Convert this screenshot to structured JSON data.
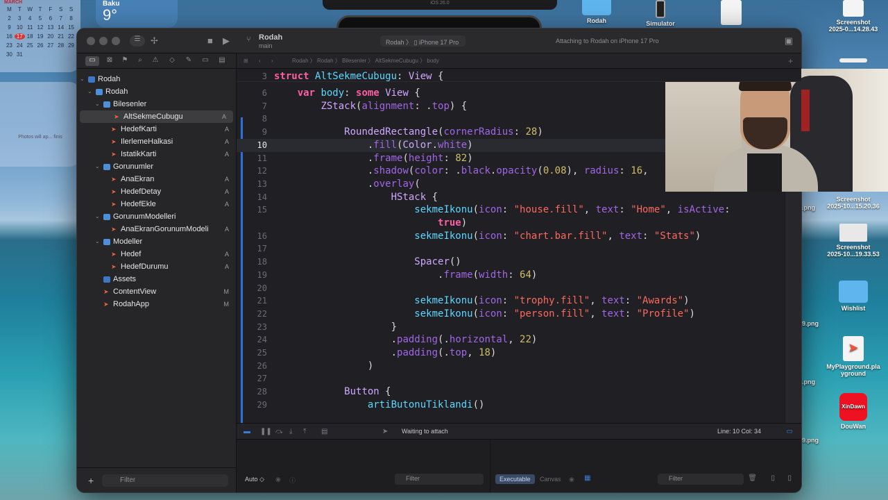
{
  "desktop": {
    "calendar": {
      "month": "MARCH",
      "weekdays": [
        "M",
        "T",
        "W",
        "T",
        "F",
        "S",
        "S"
      ],
      "rows": [
        [
          "2",
          "3",
          "4",
          "5",
          "6",
          "7",
          "8"
        ],
        [
          "9",
          "10",
          "11",
          "12",
          "13",
          "14",
          "15"
        ],
        [
          "16",
          "17",
          "18",
          "19",
          "20",
          "21",
          "22"
        ],
        [
          "23",
          "24",
          "25",
          "26",
          "27",
          "28",
          "29"
        ],
        [
          "30",
          "31",
          "",
          "",
          "",
          "",
          ""
        ]
      ],
      "today": "17"
    },
    "weather": {
      "city": "Baku",
      "temp": "9°"
    },
    "photos_widget_text": "Photos will ap... finis",
    "top_island_text": "iOS 26.0",
    "icons": [
      {
        "label": "Rodah",
        "type": "folder"
      },
      {
        "label": "Simulator",
        "type": "simulator"
      },
      {
        "label": "Screenshot\n2025-0...14.28.43",
        "type": "file"
      },
      {
        "label": "Screenshot\n2025-10...15.20.36",
        "type": "shot"
      },
      {
        "label": "Screenshot\n2025-10...19.33.53",
        "type": "shot"
      },
      {
        "label": "Wishlist",
        "type": "folder"
      },
      {
        "label": "MyPlayground.pla\nyground",
        "type": "swift"
      },
      {
        "label": "DouWan",
        "type": "app"
      }
    ],
    "side_labels": [
      ".png",
      "9.png",
      ".png",
      "9.png"
    ]
  },
  "xcode": {
    "scheme": {
      "name": "Rodah",
      "branch": "main"
    },
    "run_destination": {
      "project": "Rodah",
      "device": "iPhone 17 Pro"
    },
    "status": "Attaching to Rodah on iPhone 17 Pro",
    "jumpbar": [
      "Rodah",
      "Rodah",
      "Bilesenler",
      "AltSekmeCubugu",
      "body"
    ],
    "navigator": {
      "tree": [
        {
          "label": "Rodah",
          "depth": 0,
          "kind": "proj",
          "chev": "⌄",
          "badge": ""
        },
        {
          "label": "Rodah",
          "depth": 1,
          "kind": "folder",
          "chev": "⌄",
          "badge": ""
        },
        {
          "label": "Bilesenler",
          "depth": 2,
          "kind": "folder",
          "chev": "⌄",
          "badge": ""
        },
        {
          "label": "AltSekmeCubugu",
          "depth": 3,
          "kind": "swift",
          "chev": "",
          "badge": "A",
          "selected": true
        },
        {
          "label": "HedefKarti",
          "depth": 3,
          "kind": "swift",
          "chev": "",
          "badge": "A"
        },
        {
          "label": "IlerlemeHalkasi",
          "depth": 3,
          "kind": "swift",
          "chev": "",
          "badge": "A"
        },
        {
          "label": "IstatikKarti",
          "depth": 3,
          "kind": "swift",
          "chev": "",
          "badge": "A"
        },
        {
          "label": "Gorunumler",
          "depth": 2,
          "kind": "folder",
          "chev": "⌄",
          "badge": ""
        },
        {
          "label": "AnaEkran",
          "depth": 3,
          "kind": "swift",
          "chev": "",
          "badge": "A"
        },
        {
          "label": "HedefDetay",
          "depth": 3,
          "kind": "swift",
          "chev": "",
          "badge": "A"
        },
        {
          "label": "HedefEkle",
          "depth": 3,
          "kind": "swift",
          "chev": "",
          "badge": "A"
        },
        {
          "label": "GorunumModelleri",
          "depth": 2,
          "kind": "folder",
          "chev": "⌄",
          "badge": ""
        },
        {
          "label": "AnaEkranGorunumModeli",
          "depth": 3,
          "kind": "swift",
          "chev": "",
          "badge": "A"
        },
        {
          "label": "Modeller",
          "depth": 2,
          "kind": "folder",
          "chev": "⌄",
          "badge": ""
        },
        {
          "label": "Hedef",
          "depth": 3,
          "kind": "swift",
          "chev": "",
          "badge": "A"
        },
        {
          "label": "HedefDurumu",
          "depth": 3,
          "kind": "swift",
          "chev": "",
          "badge": "A"
        },
        {
          "label": "Assets",
          "depth": 2,
          "kind": "assets",
          "chev": "",
          "badge": ""
        },
        {
          "label": "ContentView",
          "depth": 2,
          "kind": "swift",
          "chev": "",
          "badge": "M"
        },
        {
          "label": "RodahApp",
          "depth": 2,
          "kind": "swift",
          "chev": "",
          "badge": "M"
        }
      ],
      "filter_placeholder": "Filter"
    },
    "editor": {
      "sticky": {
        "num": "3",
        "html": "<span class=\"kw\">struct</span> <span class=\"tn\">AltSekmeCubugu</span>: <span class=\"ty\">View</span> {"
      },
      "current_line": "10",
      "lines": [
        {
          "num": "6",
          "html": "    <span class=\"kw\">var</span> <span class=\"tn\">body</span>: <span class=\"kw\">some</span> <span class=\"ty\">View</span> {"
        },
        {
          "num": "7",
          "html": "        <span class=\"ty\">ZStack</span>(<span class=\"mb\">alignment</span>: .<span class=\"mb\">top</span>) {"
        },
        {
          "num": "8",
          "html": ""
        },
        {
          "num": "9",
          "html": "            <span class=\"ty\">RoundedRectangle</span>(<span class=\"mb\">cornerRadius</span>: <span class=\"nm\">28</span>)"
        },
        {
          "num": "10",
          "html": "                .<span class=\"mb\">fill</span>(<span class=\"ty\">Color</span>.<span class=\"mb\">white</span>)"
        },
        {
          "num": "11",
          "html": "                .<span class=\"mb\">frame</span>(<span class=\"mb\">height</span>: <span class=\"nm\">82</span>)"
        },
        {
          "num": "12",
          "html": "                .<span class=\"mb\">shadow</span>(<span class=\"mb\">color</span>: .<span class=\"mb\">black</span>.<span class=\"mb\">opacity</span>(<span class=\"nm\">0.08</span>), <span class=\"mb\">radius</span>: <span class=\"nm\">16</span>,"
        },
        {
          "num": "13",
          "html": "                .<span class=\"mb\">overlay</span>("
        },
        {
          "num": "14",
          "html": "                    <span class=\"ty\">HStack</span> {"
        },
        {
          "num": "15",
          "html": "                        <span class=\"tn\">sekmeIkonu</span>(<span class=\"mb\">icon</span>: <span class=\"st\">\"house.fill\"</span>, <span class=\"mb\">text</span>: <span class=\"st\">\"Home\"</span>, <span class=\"mb\">isActive</span>:"
        },
        {
          "num": "",
          "html": "                            <span class=\"kw\">true</span>)"
        },
        {
          "num": "16",
          "html": "                        <span class=\"tn\">sekmeIkonu</span>(<span class=\"mb\">icon</span>: <span class=\"st\">\"chart.bar.fill\"</span>, <span class=\"mb\">text</span>: <span class=\"st\">\"Stats\"</span>)"
        },
        {
          "num": "17",
          "html": ""
        },
        {
          "num": "18",
          "html": "                        <span class=\"ty\">Spacer</span>()"
        },
        {
          "num": "19",
          "html": "                            .<span class=\"mb\">frame</span>(<span class=\"mb\">width</span>: <span class=\"nm\">64</span>)"
        },
        {
          "num": "20",
          "html": ""
        },
        {
          "num": "21",
          "html": "                        <span class=\"tn\">sekmeIkonu</span>(<span class=\"mb\">icon</span>: <span class=\"st\">\"trophy.fill\"</span>, <span class=\"mb\">text</span>: <span class=\"st\">\"Awards\"</span>)"
        },
        {
          "num": "22",
          "html": "                        <span class=\"tn\">sekmeIkonu</span>(<span class=\"mb\">icon</span>: <span class=\"st\">\"person.fill\"</span>, <span class=\"mb\">text</span>: <span class=\"st\">\"Profile\"</span>)"
        },
        {
          "num": "23",
          "html": "                    }"
        },
        {
          "num": "24",
          "html": "                    .<span class=\"mb\">padding</span>(.<span class=\"mb\">horizontal</span>, <span class=\"nm\">22</span>)"
        },
        {
          "num": "25",
          "html": "                    .<span class=\"mb\">padding</span>(.<span class=\"mb\">top</span>, <span class=\"nm\">18</span>)"
        },
        {
          "num": "26",
          "html": "                )"
        },
        {
          "num": "27",
          "html": ""
        },
        {
          "num": "28",
          "html": "            <span class=\"ty\">Button</span> {"
        },
        {
          "num": "29",
          "html": "                <span class=\"tn\">artiButonuTiklandi</span>()"
        }
      ]
    },
    "debug": {
      "status": "Waiting to attach",
      "position": "Line: 10  Col: 34"
    },
    "console": {
      "auto_label": "Auto ◇",
      "filter_placeholder": "Filter",
      "executable_label": "Executable",
      "canvas_label": "Canvas",
      "right_filter_placeholder": "Filter"
    }
  }
}
